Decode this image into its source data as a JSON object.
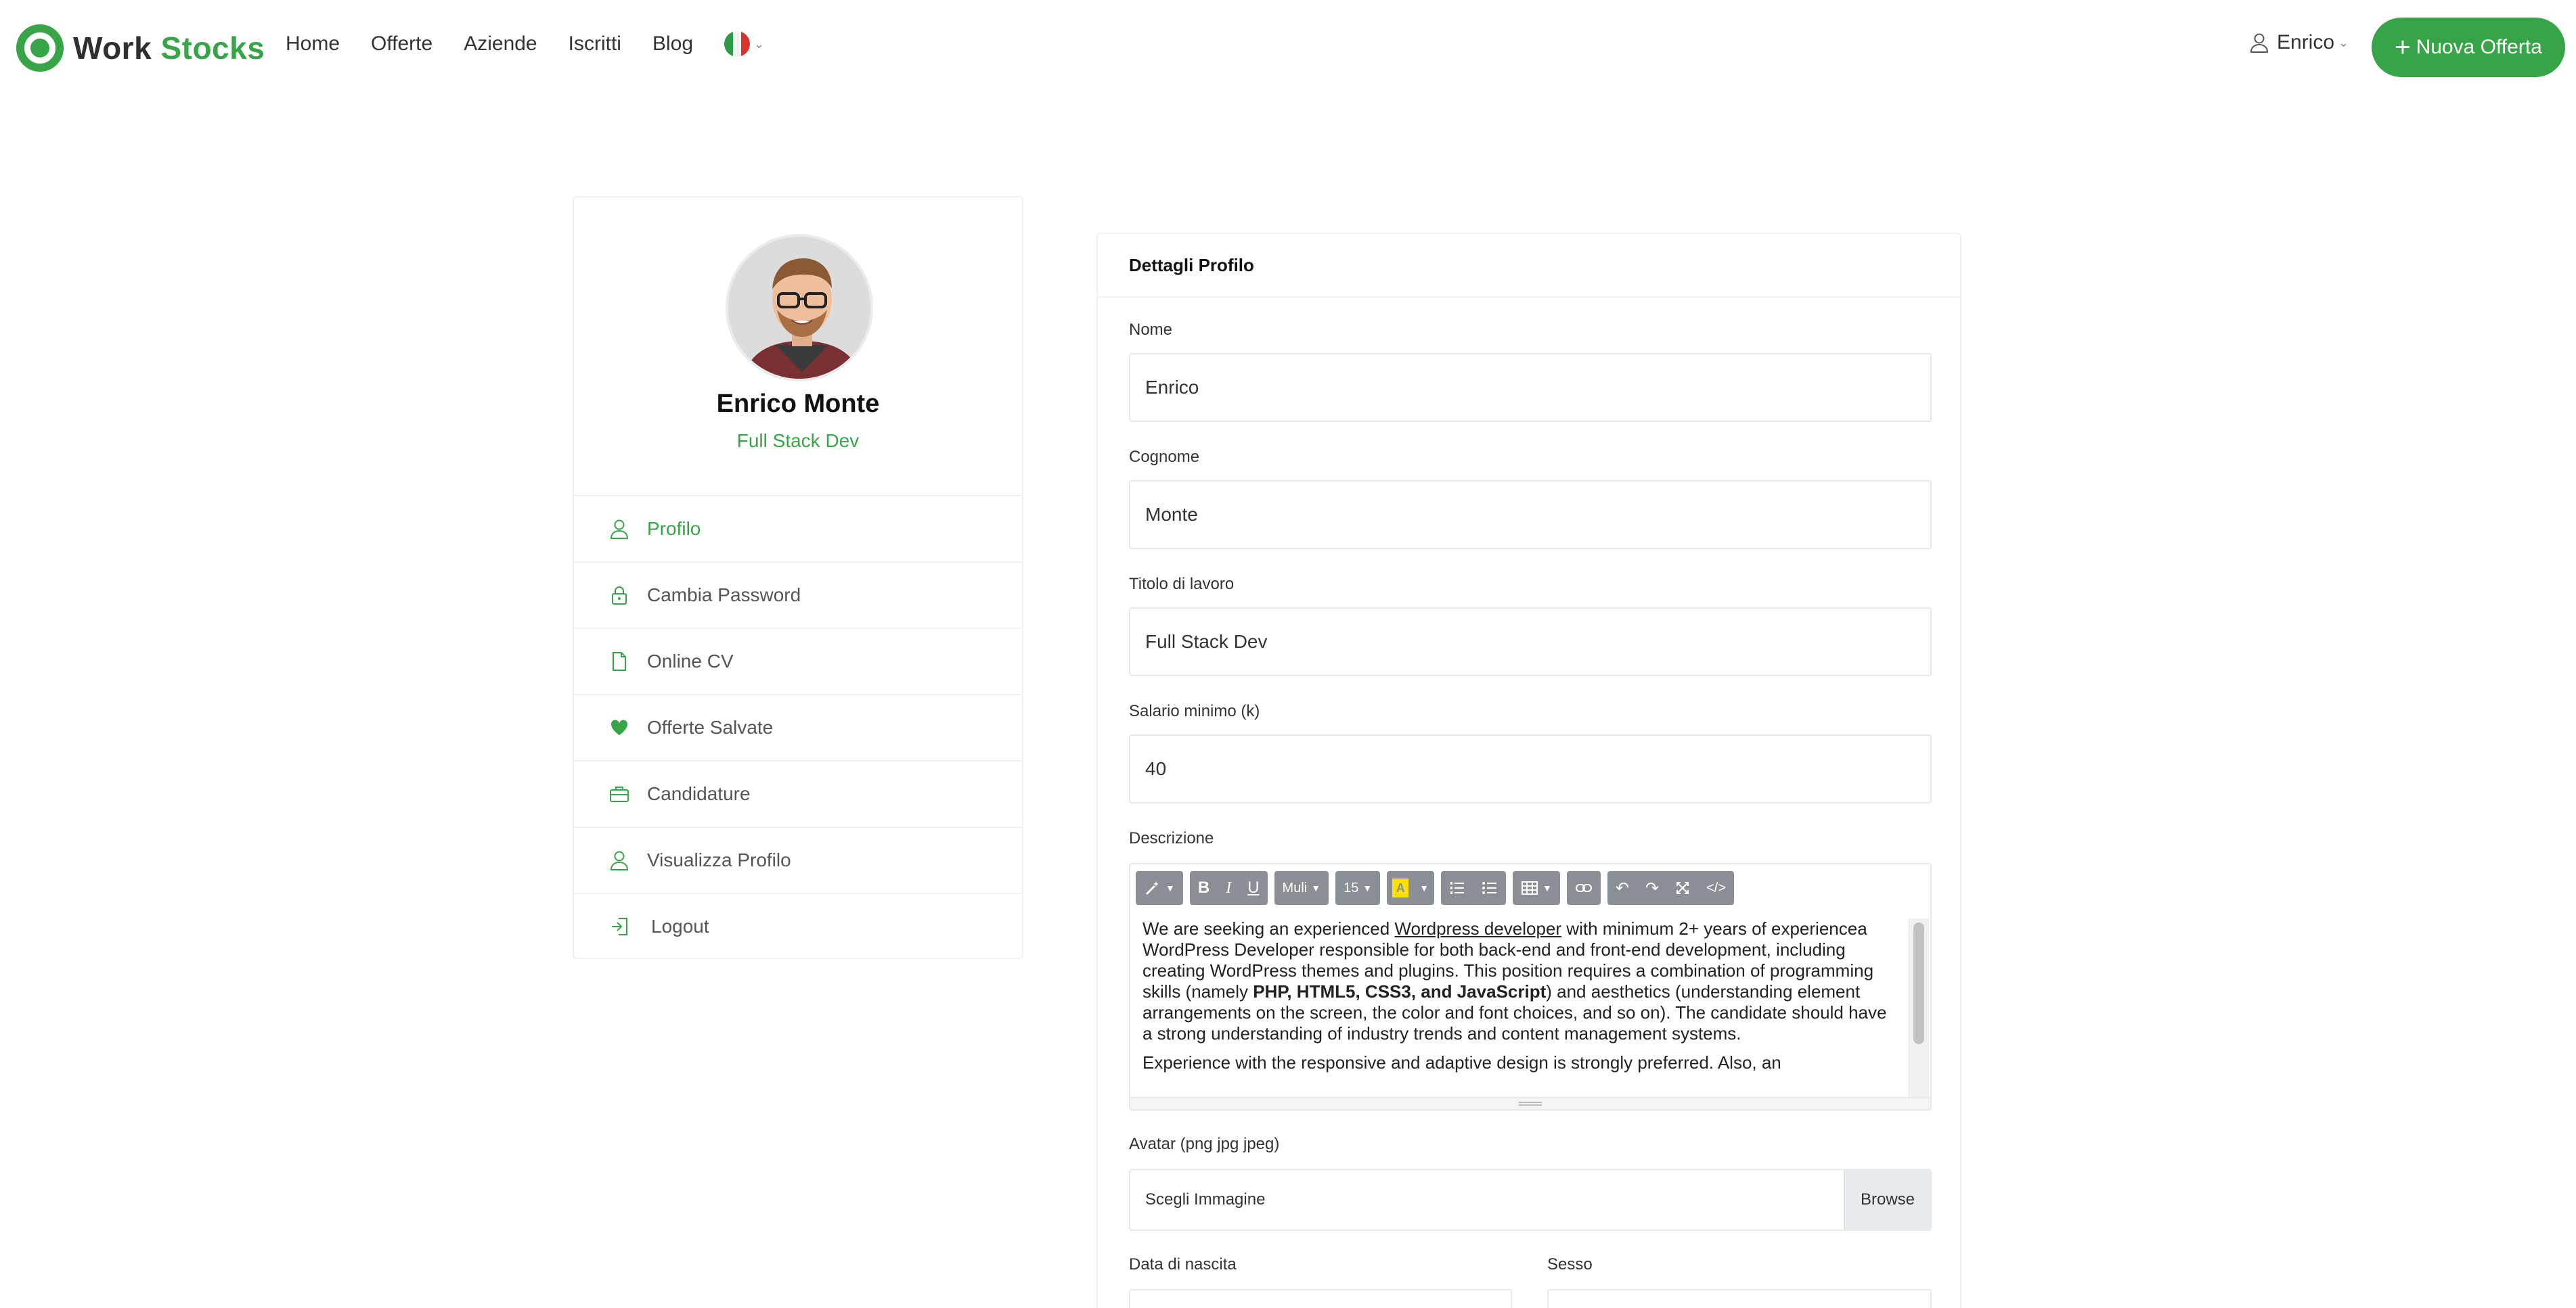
{
  "brand": {
    "name_part1": "Work",
    "name_part2": "Stocks",
    "color": "#37a547"
  },
  "nav": {
    "items": [
      "Home",
      "Offerte",
      "Aziende",
      "Iscritti",
      "Blog"
    ],
    "language_flag": "italian-flag-icon"
  },
  "user_menu": {
    "name": "Enrico",
    "icon": "user-icon"
  },
  "new_offer_button": {
    "label": "Nuova Offerta"
  },
  "profile": {
    "name": "Enrico Monte",
    "role": "Full Stack Dev",
    "menu": [
      {
        "label": "Profilo",
        "icon": "user-icon",
        "active": true
      },
      {
        "label": "Cambia Password",
        "icon": "lock-icon",
        "active": false
      },
      {
        "label": "Online CV",
        "icon": "file-icon",
        "active": false
      },
      {
        "label": "Offerte Salvate",
        "icon": "heart-icon",
        "active": false
      },
      {
        "label": "Candidature",
        "icon": "briefcase-icon",
        "active": false
      },
      {
        "label": "Visualizza Profilo",
        "icon": "user-icon",
        "active": false
      },
      {
        "label": "Logout",
        "icon": "logout-icon",
        "active": false
      }
    ]
  },
  "form": {
    "title": "Dettagli Profilo",
    "nome": {
      "label": "Nome",
      "value": "Enrico"
    },
    "cognome": {
      "label": "Cognome",
      "value": "Monte"
    },
    "titolo": {
      "label": "Titolo di lavoro",
      "value": "Full Stack Dev"
    },
    "salario": {
      "label": "Salario minimo (k)",
      "value": "40"
    },
    "descrizione": {
      "label": "Descrizione",
      "toolbar": {
        "font": "Muli",
        "size": "15"
      },
      "p1_a": "We are seeking an experienced ",
      "p1_link": "Wordpress developer",
      "p1_b": " with minimum 2+ years of experiencea WordPress Developer responsible for both back-end and front-end development, including creating WordPress themes and plugins. This position requires a combination of programming skills (namely ",
      "p1_bold": "PHP, HTML5, CSS3, and JavaScript",
      "p1_c": ") and aesthetics (understanding element arrangements on the screen, the color and font choices, and so on). The candidate should have a strong understanding of industry trends and content management systems.",
      "p2": "Experience with the responsive and adaptive design is strongly preferred. Also, an"
    },
    "avatar": {
      "label": "Avatar (png jpg jpeg)",
      "placeholder": "Scegli Immagine",
      "browse": "Browse"
    },
    "data_nascita": {
      "label": "Data di nascita"
    },
    "sesso": {
      "label": "Sesso"
    }
  }
}
